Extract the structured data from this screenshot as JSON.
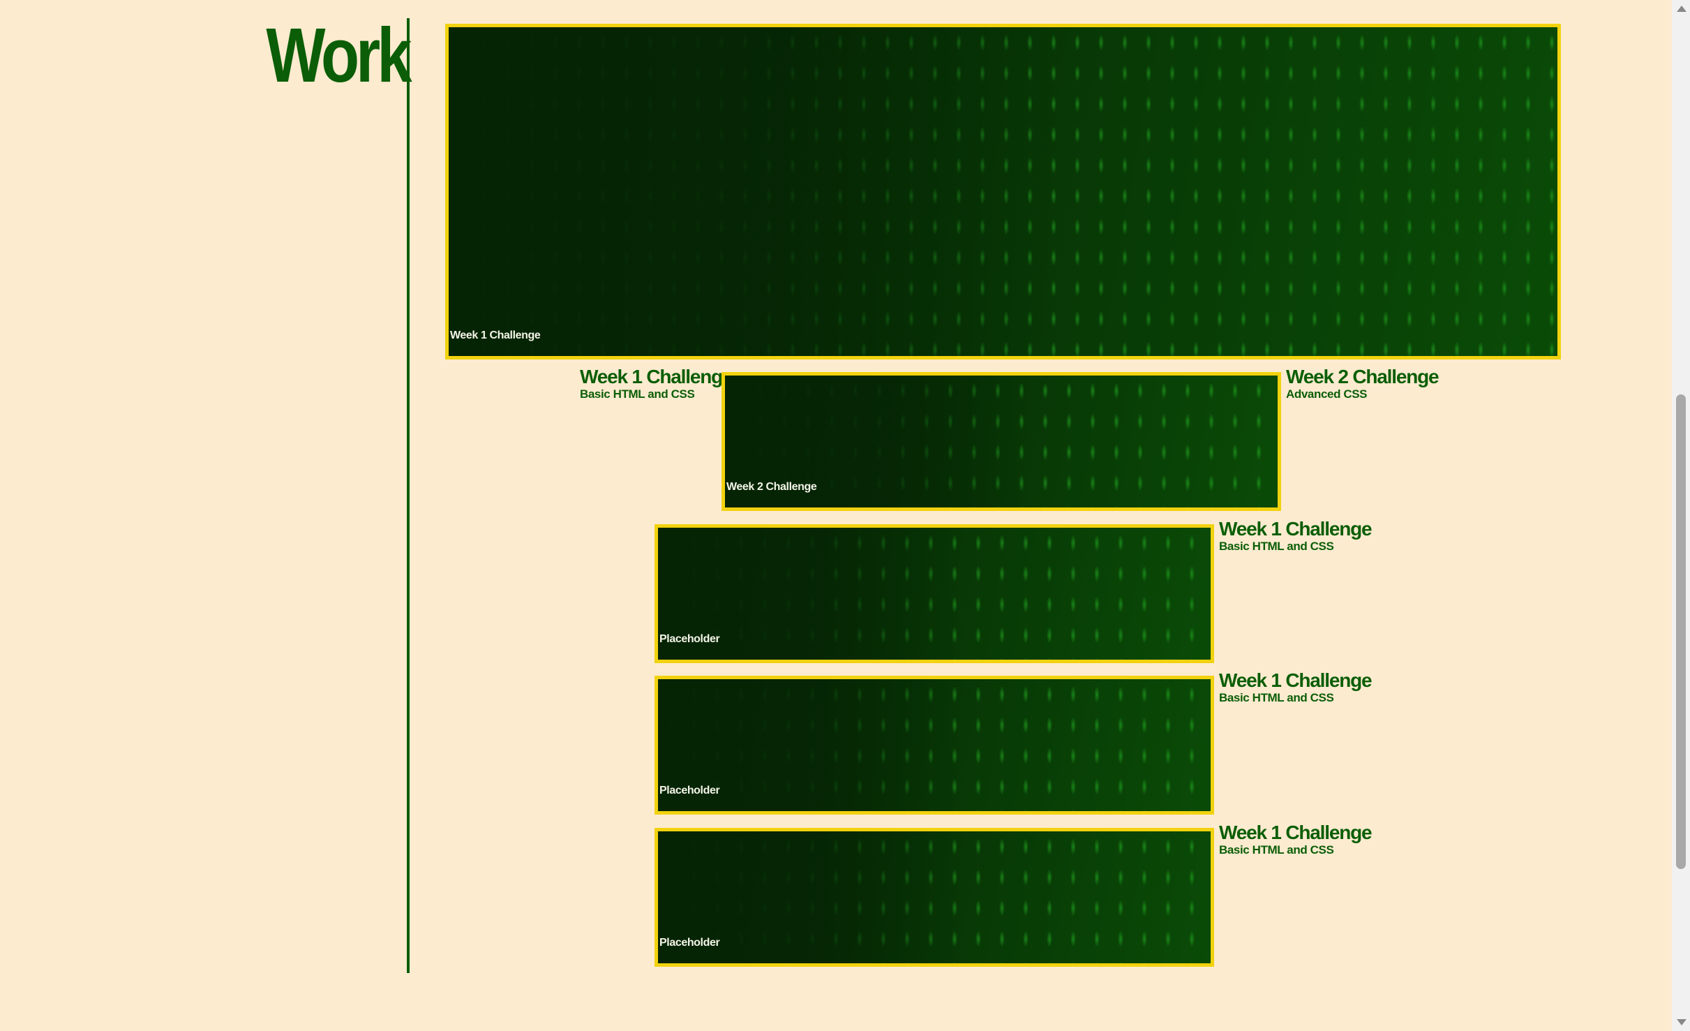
{
  "section": {
    "title": "Work"
  },
  "featured": {
    "caption": "Week 1 Challenge"
  },
  "projects": [
    {
      "caption": "Week 2 Challenge",
      "left_title": "Week 1 Challenge",
      "left_subtitle": "Basic HTML and CSS",
      "right_title": "Week 2 Challenge",
      "right_subtitle": "Advanced CSS"
    },
    {
      "caption": "Placeholder",
      "title": "Week 1 Challenge",
      "subtitle": "Basic HTML and CSS"
    },
    {
      "caption": "Placeholder",
      "title": "Week 1 Challenge",
      "subtitle": "Basic HTML and CSS"
    },
    {
      "caption": "Placeholder",
      "title": "Week 1 Challenge",
      "subtitle": "Basic HTML and CSS"
    }
  ],
  "colors": {
    "background": "#fdebd0",
    "accent_green": "#0b5e07",
    "card_border": "#f2d20f"
  }
}
